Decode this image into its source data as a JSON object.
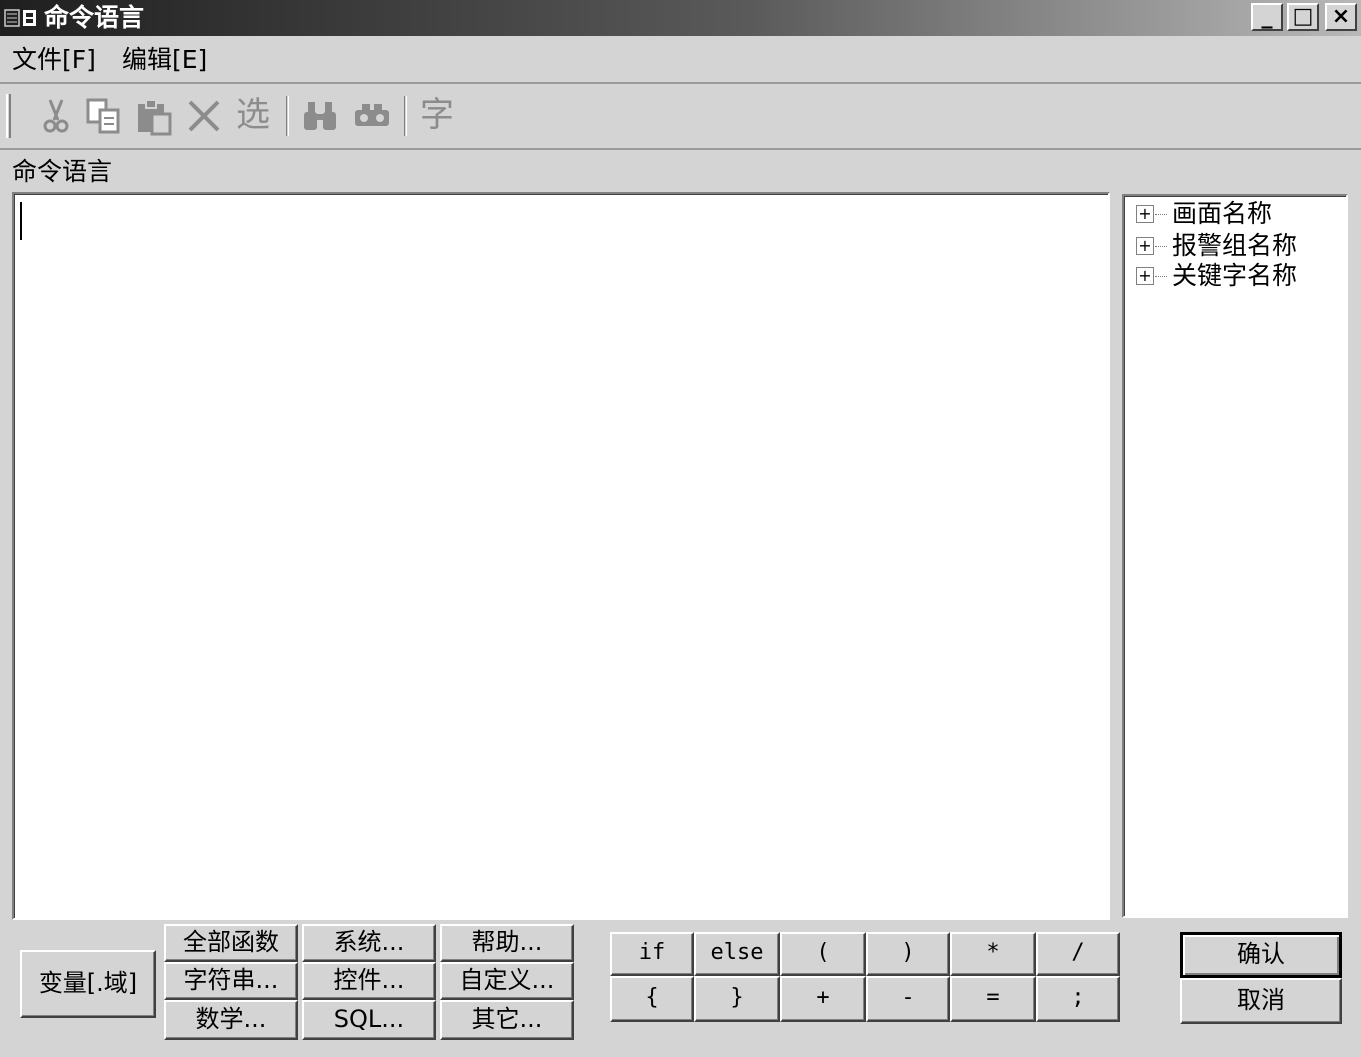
{
  "window": {
    "title": "命令语言",
    "minimize": "_",
    "maximize": "□",
    "close": "×"
  },
  "menu": [
    "文件[F]",
    "编辑[E]"
  ],
  "toolbar": {
    "icons": [
      "cut-icon",
      "copy-icon",
      "paste-icon",
      "delete-icon",
      "select-icon",
      "find-icon",
      "replace-icon",
      "font-icon"
    ],
    "select_label": "选",
    "font_label": "字"
  },
  "editor": {
    "label": "命令语言",
    "content": ""
  },
  "tree": {
    "nodes": [
      "画面名称",
      "报警组名称",
      "关键字名称"
    ]
  },
  "buttons": {
    "variable": "变量[.域]",
    "functions": [
      "全部函数",
      "系统...",
      "帮助...",
      "字符串...",
      "控件...",
      "自定义...",
      "数学...",
      "SQL...",
      "其它..."
    ],
    "operators": [
      "if",
      "else",
      "(",
      ")",
      "*",
      "/",
      "{",
      "}",
      "+",
      "-",
      "=",
      ";"
    ],
    "ok": "确认",
    "cancel": "取消"
  }
}
